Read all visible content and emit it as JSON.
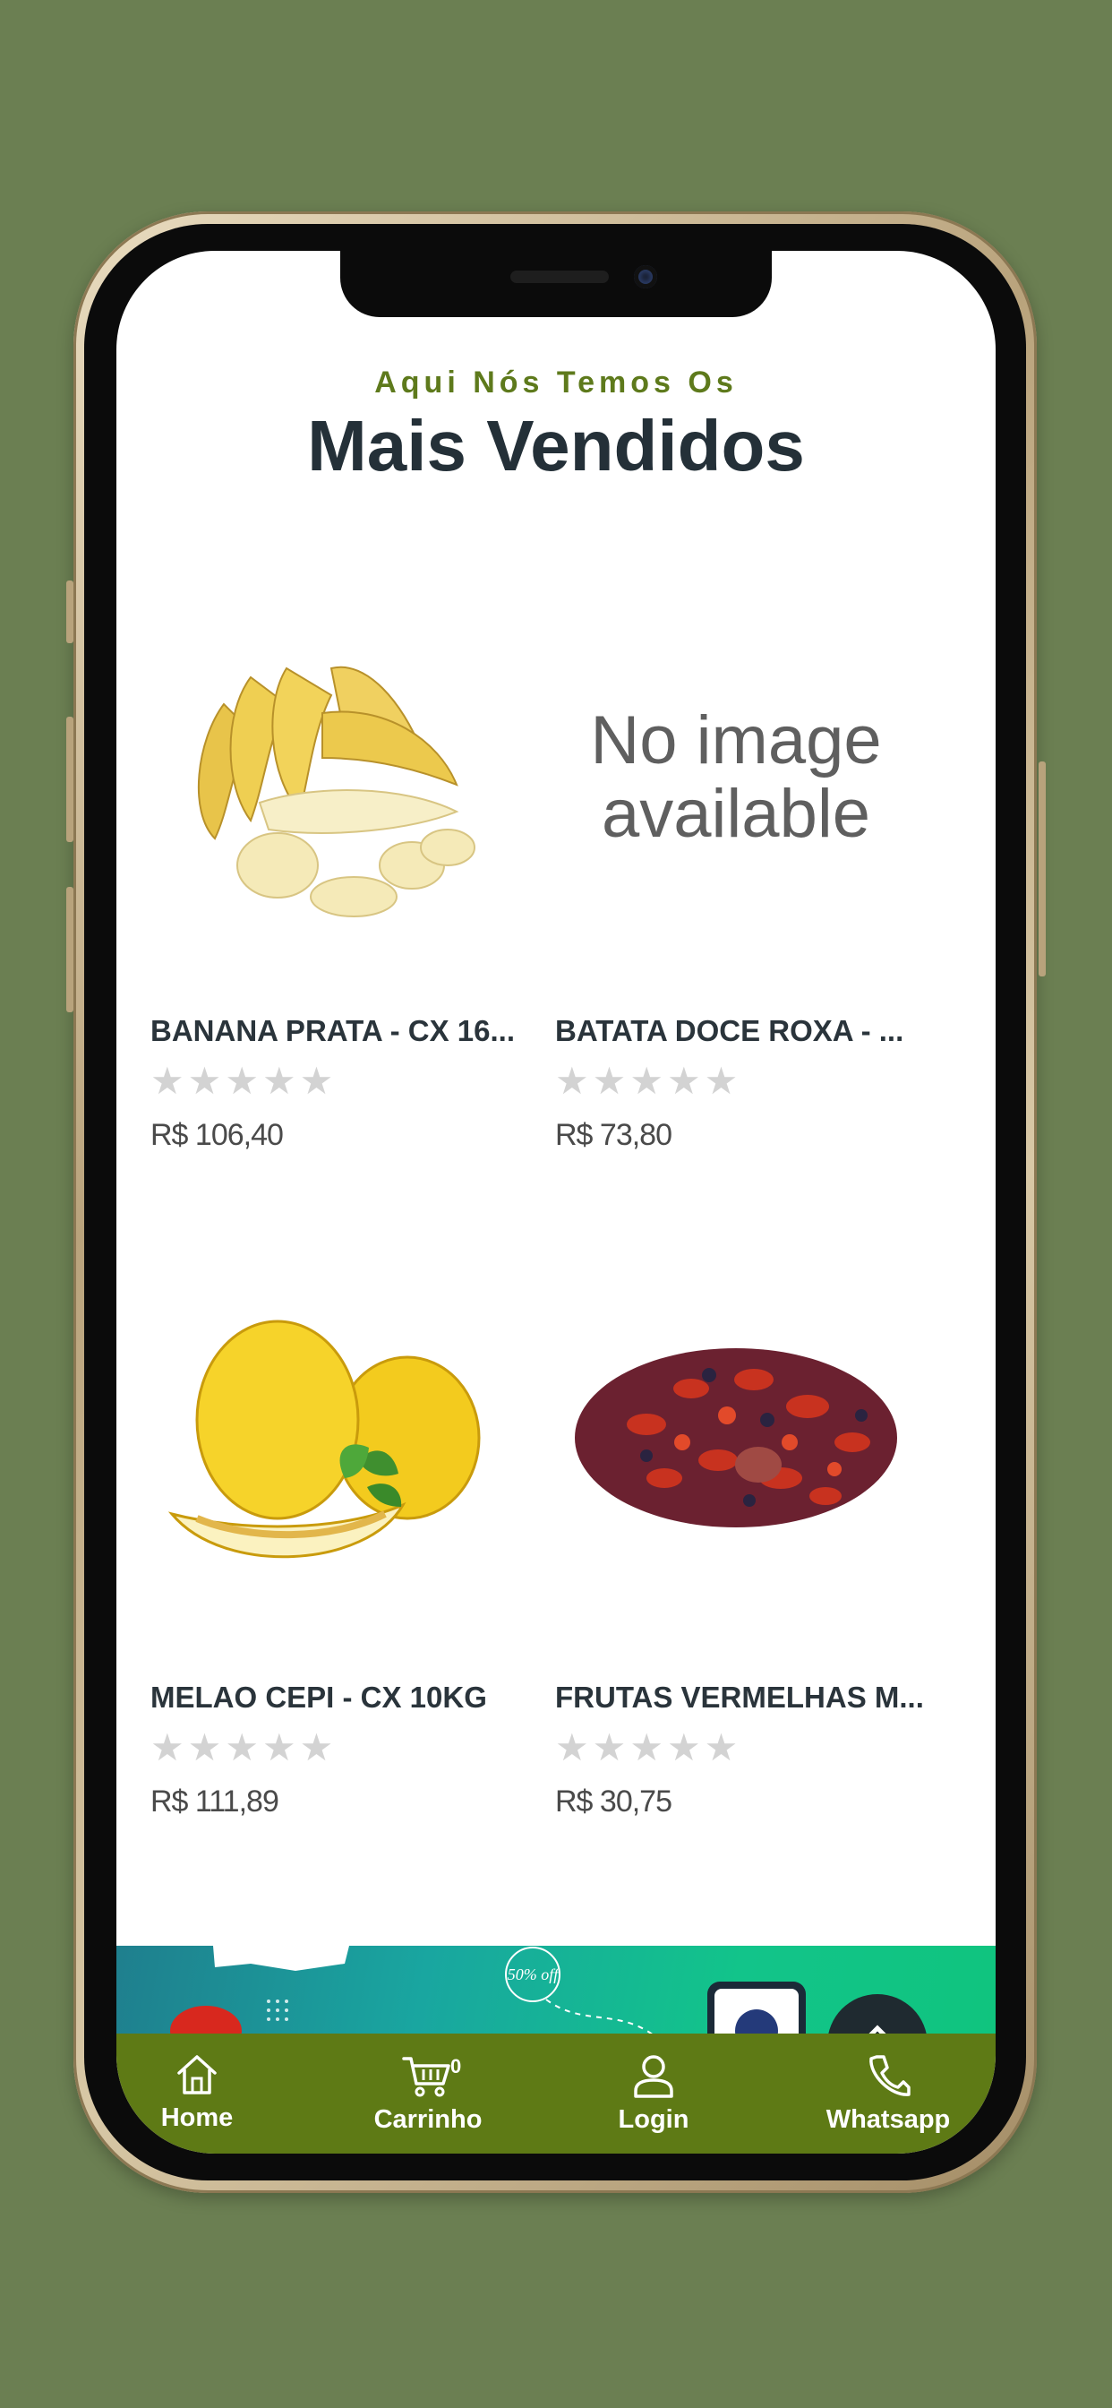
{
  "header": {
    "subtitle": "Aqui Nós Temos Os",
    "title": "Mais Vendidos"
  },
  "products": [
    {
      "name": "BANANA PRATA - CX 16...",
      "price": "R$ 106,40",
      "rating": 0,
      "image": "banana"
    },
    {
      "name": "BATATA DOCE ROXA - ...",
      "price": "R$ 73,80",
      "rating": 0,
      "image": "no-image",
      "image_text_line1": "No image",
      "image_text_line2": "available"
    },
    {
      "name": "MELAO CEPI - CX 10KG",
      "price": "R$ 111,89",
      "rating": 0,
      "image": "melon"
    },
    {
      "name": "FRUTAS VERMELHAS M...",
      "price": "R$ 30,75",
      "rating": 0,
      "image": "red-fruits"
    }
  ],
  "banner": {
    "badge": "50% off"
  },
  "tab_bar": {
    "home": "Home",
    "cart": "Carrinho",
    "cart_count": "0",
    "login": "Login",
    "whatsapp": "Whatsapp"
  },
  "colors": {
    "background": "#6b7f52",
    "accent": "#5e7a15",
    "title": "#243038"
  }
}
